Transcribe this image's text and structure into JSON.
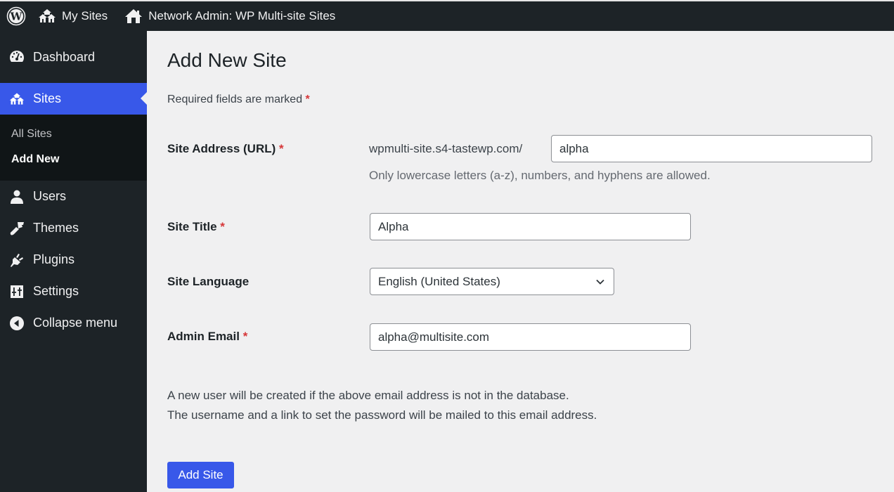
{
  "adminbar": {
    "wp_logo_icon": "wordpress-logo-icon",
    "my_sites_label": "My Sites",
    "network_label": "Network Admin: WP Multi-site Sites"
  },
  "sidebar": {
    "items": [
      {
        "label": "Dashboard",
        "icon": "dashboard-icon"
      },
      {
        "label": "Sites",
        "icon": "sites-icon",
        "active": true
      },
      {
        "label": "Users",
        "icon": "users-icon"
      },
      {
        "label": "Themes",
        "icon": "themes-icon"
      },
      {
        "label": "Plugins",
        "icon": "plugins-icon"
      },
      {
        "label": "Settings",
        "icon": "settings-icon"
      },
      {
        "label": "Collapse menu",
        "icon": "collapse-icon"
      }
    ],
    "submenu": [
      {
        "label": "All Sites"
      },
      {
        "label": "Add New",
        "current": true
      }
    ]
  },
  "page": {
    "title": "Add New Site",
    "required_note": "Required fields are marked",
    "required_marker": "*"
  },
  "form": {
    "site_address": {
      "label": "Site Address (URL)",
      "prefix": "wpmulti-site.s4-tastewp.com/",
      "value": "alpha",
      "hint": "Only lowercase letters (a-z), numbers, and hyphens are allowed."
    },
    "site_title": {
      "label": "Site Title",
      "value": "Alpha"
    },
    "site_language": {
      "label": "Site Language",
      "value": "English (United States)"
    },
    "admin_email": {
      "label": "Admin Email",
      "value": "alpha@multisite.com"
    },
    "info_line_1": "A new user will be created if the above email address is not in the database.",
    "info_line_2": "The username and a link to set the password will be mailed to this email address.",
    "submit_label": "Add Site"
  },
  "colors": {
    "accent": "#3858e9",
    "required": "#d63638",
    "sidebar_bg": "#1d2327"
  }
}
